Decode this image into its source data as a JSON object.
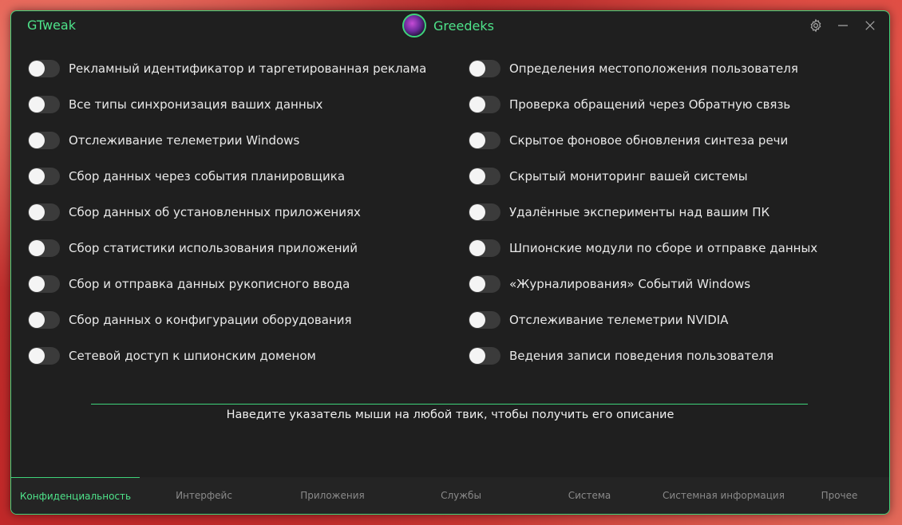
{
  "app": {
    "title": "GTweak",
    "user_name": "Greedeks"
  },
  "window_buttons": {
    "settings": "gear-icon",
    "minimize": "minimize-icon",
    "close": "close-icon"
  },
  "tweaks_left": [
    "Рекламный идентификатор и таргетированная реклама",
    "Все типы синхронизация ваших данных",
    "Отслеживание телеметрии Windows",
    "Сбор данных через события планировщика",
    "Сбор данных об установленных приложениях",
    "Сбор статистики использования приложений",
    "Сбор и отправка данных рукописного ввода",
    "Сбор данных о конфигурации оборудования",
    "Сетевой доступ к шпионским доменом"
  ],
  "tweaks_right": [
    "Определения местоположения пользователя",
    "Проверка обращений через Обратную связь",
    "Скрытое фоновое обновления синтеза речи",
    "Скрытый мониторинг вашей системы",
    "Удалённые эксперименты над вашим ПК",
    "Шпионские модули по сборе и отправке данных",
    "«Журналирования» Событий Windows",
    "Отслеживание телеметрии NVIDIA",
    "Ведения записи поведения пользователя"
  ],
  "hint": "Наведите указатель мыши на любой твик, чтобы получить его описание",
  "tabs": [
    {
      "label": "Конфиденциальность",
      "active": true
    },
    {
      "label": "Интерфейс",
      "active": false
    },
    {
      "label": "Приложения",
      "active": false
    },
    {
      "label": "Службы",
      "active": false
    },
    {
      "label": "Система",
      "active": false
    },
    {
      "label": "Системная информация",
      "active": false
    },
    {
      "label": "Прочее",
      "active": false
    }
  ],
  "colors": {
    "accent": "#4ee38a",
    "window_bg": "#1f1f1f",
    "toggle_off": "#3b3b3b"
  }
}
